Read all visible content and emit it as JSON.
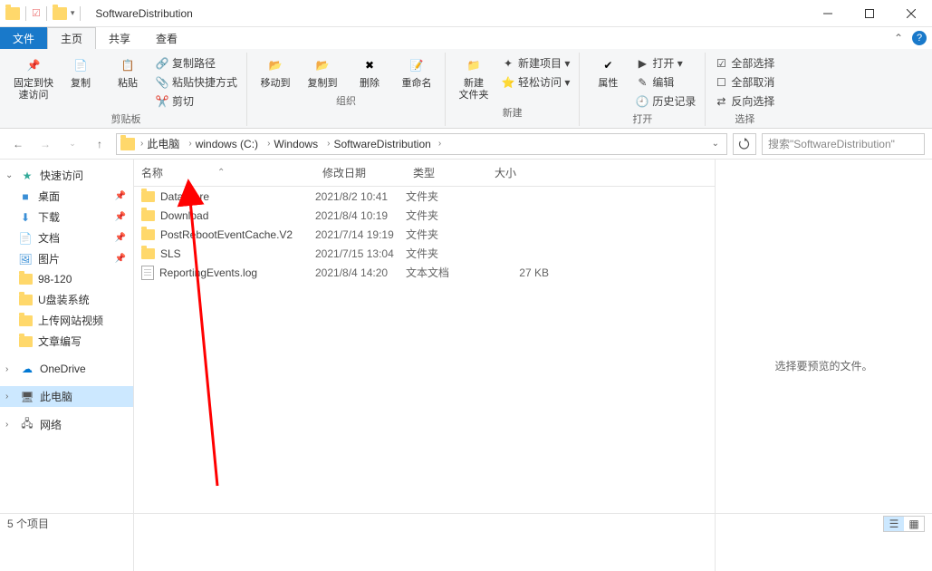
{
  "window": {
    "title": "SoftwareDistribution"
  },
  "tabs": {
    "file": "文件",
    "home": "主页",
    "share": "共享",
    "view": "查看"
  },
  "ribbon": {
    "pin": "固定到快\n速访问",
    "copy": "复制",
    "paste": "粘贴",
    "copy_path": "复制路径",
    "paste_shortcut": "粘贴快捷方式",
    "cut": "剪切",
    "g_clipboard": "剪贴板",
    "move": "移动到",
    "copyto": "复制到",
    "delete": "删除",
    "rename": "重命名",
    "g_organize": "组织",
    "newfolder": "新建\n文件夹",
    "new_item": "新建项目 ▾",
    "easy_access": "轻松访问 ▾",
    "g_new": "新建",
    "properties": "属性",
    "open": "打开 ▾",
    "edit": "编辑",
    "history": "历史记录",
    "g_open": "打开",
    "select_all": "全部选择",
    "select_none": "全部取消",
    "invert": "反向选择",
    "g_select": "选择"
  },
  "breadcrumbs": [
    "此电脑",
    "windows (C:)",
    "Windows",
    "SoftwareDistribution"
  ],
  "search": {
    "placeholder": "搜索\"SoftwareDistribution\""
  },
  "sidebar": {
    "quick": "快速访问",
    "desktop": "桌面",
    "downloads": "下载",
    "documents": "文档",
    "pictures": "图片",
    "f1": "98-120",
    "f2": "U盘装系统",
    "f3": "上传网站视频",
    "f4": "文章编写",
    "onedrive": "OneDrive",
    "thispc": "此电脑",
    "network": "网络"
  },
  "columns": {
    "name": "名称",
    "date": "修改日期",
    "type": "类型",
    "size": "大小"
  },
  "rows": [
    {
      "name": "DataStore",
      "date": "2021/8/2 10:41",
      "type": "文件夹",
      "size": "",
      "icon": "folder"
    },
    {
      "name": "Download",
      "date": "2021/8/4 10:19",
      "type": "文件夹",
      "size": "",
      "icon": "folder"
    },
    {
      "name": "PostRebootEventCache.V2",
      "date": "2021/7/14 19:19",
      "type": "文件夹",
      "size": "",
      "icon": "folder"
    },
    {
      "name": "SLS",
      "date": "2021/7/15 13:04",
      "type": "文件夹",
      "size": "",
      "icon": "folder"
    },
    {
      "name": "ReportingEvents.log",
      "date": "2021/8/4 14:20",
      "type": "文本文档",
      "size": "27 KB",
      "icon": "doc"
    }
  ],
  "preview": "选择要预览的文件。",
  "status": "5 个项目"
}
